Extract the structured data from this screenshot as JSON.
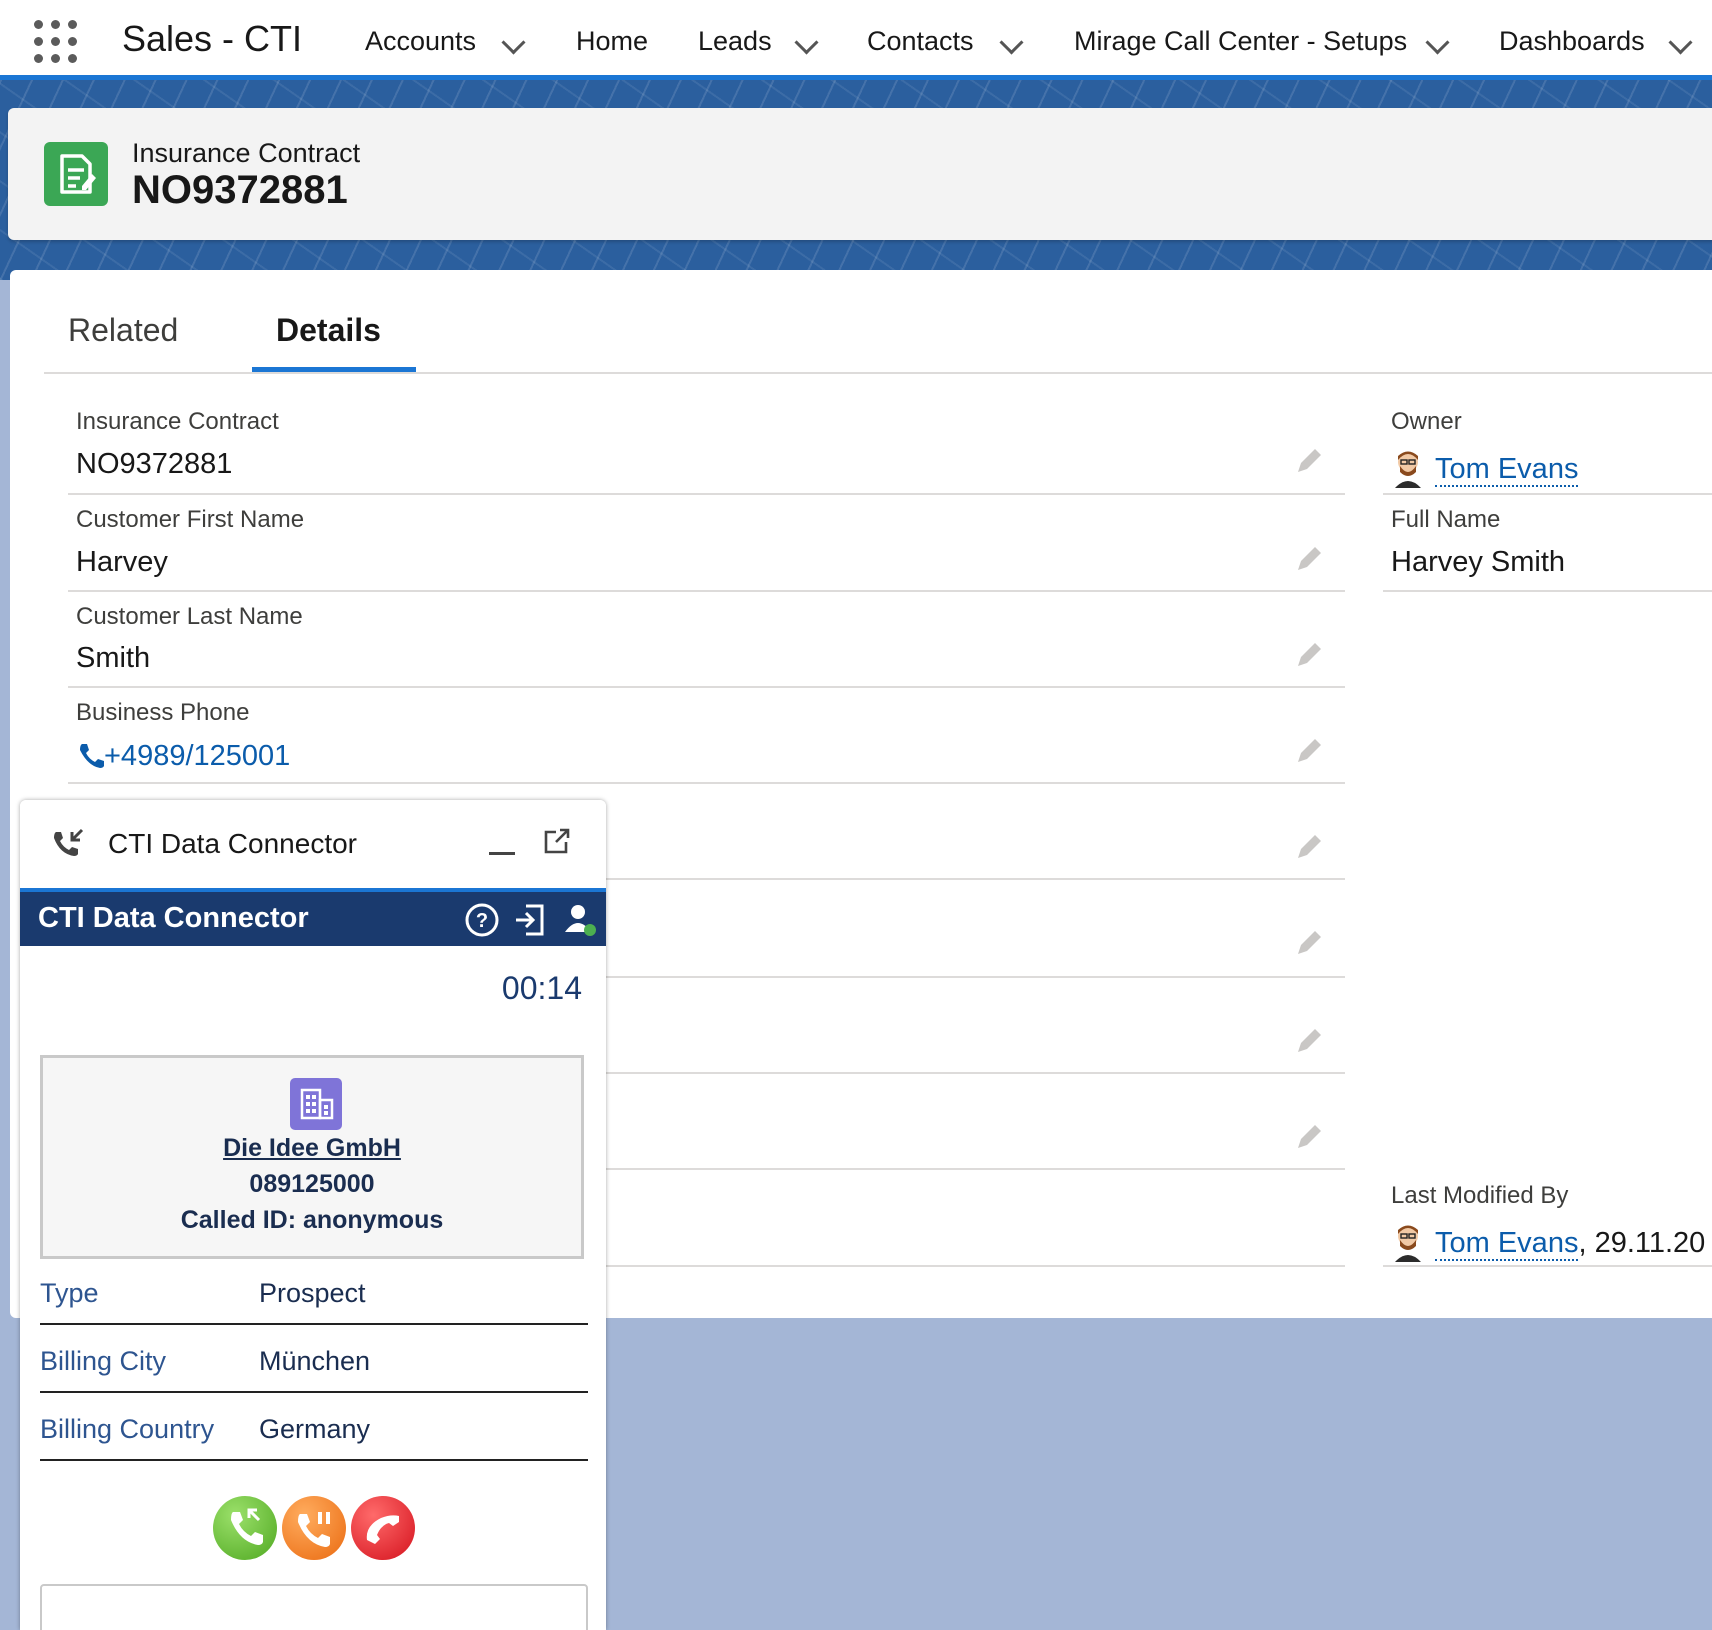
{
  "nav": {
    "app_name": "Sales - CTI",
    "items": [
      {
        "label": "Accounts",
        "has_dropdown": true
      },
      {
        "label": "Home",
        "has_dropdown": false
      },
      {
        "label": "Leads",
        "has_dropdown": true
      },
      {
        "label": "Contacts",
        "has_dropdown": true
      },
      {
        "label": "Mirage Call Center - Setups",
        "has_dropdown": true
      },
      {
        "label": "Dashboards",
        "has_dropdown": true
      }
    ]
  },
  "record": {
    "type_label": "Insurance Contract",
    "name": "NO9372881",
    "icon": "contract-icon",
    "icon_color": "#3ba755"
  },
  "tabs": {
    "related": "Related",
    "details": "Details",
    "active": "Details"
  },
  "fields_left": [
    {
      "label": "Insurance Contract",
      "value": "NO9372881"
    },
    {
      "label": "Customer First Name",
      "value": "Harvey"
    },
    {
      "label": "Customer Last Name",
      "value": "Smith"
    },
    {
      "label": "Business Phone",
      "value": "+4989/125001"
    }
  ],
  "fields_right": {
    "owner_label": "Owner",
    "owner_value": "Tom Evans",
    "full_name_label": "Full Name",
    "full_name_value": "Harvey Smith",
    "last_modified_label": "Last Modified By",
    "last_modified_user": "Tom Evans",
    "last_modified_date": ", 29.11.20"
  },
  "cti": {
    "window_title": "CTI Data Connector",
    "header_title": "CTI Data Connector",
    "timer": "00:14",
    "caller": {
      "account_name": "Die Idee GmbH",
      "phone": "089125000",
      "called_id": "Called ID: anonymous"
    },
    "details": [
      {
        "label": "Type",
        "value": "Prospect"
      },
      {
        "label": "Billing City",
        "value": "München"
      },
      {
        "label": "Billing Country",
        "value": "Germany"
      }
    ],
    "colors": {
      "header": "#1a3a6e",
      "answer": "#5cb82e",
      "hold": "#f07a1a",
      "hangup": "#e0202a"
    }
  },
  "colors": {
    "brand_blue": "#1b76d4",
    "link": "#0b5cab"
  }
}
